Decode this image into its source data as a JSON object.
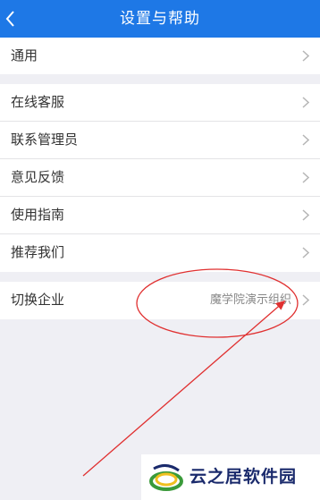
{
  "header": {
    "title": "设置与帮助"
  },
  "groups": [
    {
      "items": [
        {
          "label": "通用"
        }
      ]
    },
    {
      "items": [
        {
          "label": "在线客服"
        },
        {
          "label": "联系管理员"
        },
        {
          "label": "意见反馈"
        },
        {
          "label": "使用指南"
        },
        {
          "label": "推荐我们"
        }
      ]
    },
    {
      "items": [
        {
          "label": "切换企业",
          "value": "魔学院演示组织"
        }
      ]
    }
  ],
  "watermark": {
    "text": "云之居软件园"
  },
  "colors": {
    "header": "#1e78e6",
    "annotation": "#e03030",
    "background": "#efeff4"
  }
}
